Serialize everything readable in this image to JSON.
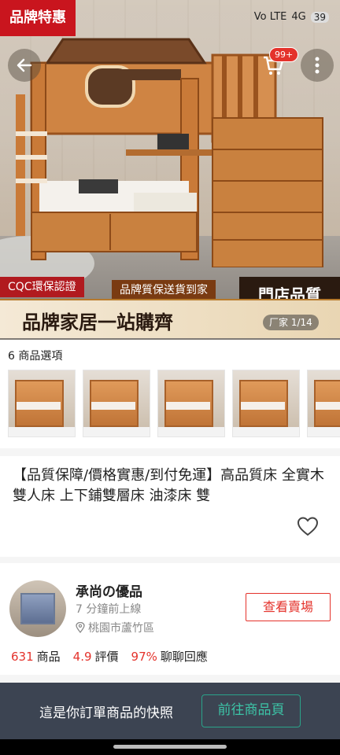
{
  "hero": {
    "promo_tag": "品牌特惠",
    "cart_badge": "99+",
    "image_counter": "1/14",
    "banner_certification": "CQC環保認證",
    "banner_quality": "品牌質保送貨到家",
    "banner_store": "門店品質",
    "banner_title": "品牌家居一站購齊",
    "banner_factory": "厂家"
  },
  "status_bar": {
    "network": "Vo LTE",
    "signal": "4G",
    "battery": "39"
  },
  "options": {
    "label": "6 商品選項"
  },
  "product": {
    "title": "【品質保障/價格實惠/到付免運】高品質床 全實木雙人床 上下鋪雙層床 油漆床 雙"
  },
  "shop": {
    "name": "承尚の優品",
    "online": "7 分鐘前上線",
    "location": "桃園市蘆竹區",
    "view_button": "查看賣場",
    "products_count": "631",
    "products_label": "商品",
    "rating": "4.9",
    "rating_label": "評價",
    "response_rate": "97%",
    "response_label": "聊聊回應"
  },
  "bottom_bar": {
    "message": "這是你訂單商品的快照",
    "goto_button": "前往商品頁"
  },
  "colors": {
    "accent_red": "#e4322b",
    "bottom_bar": "#3c4452",
    "teal": "#2aa38a"
  }
}
